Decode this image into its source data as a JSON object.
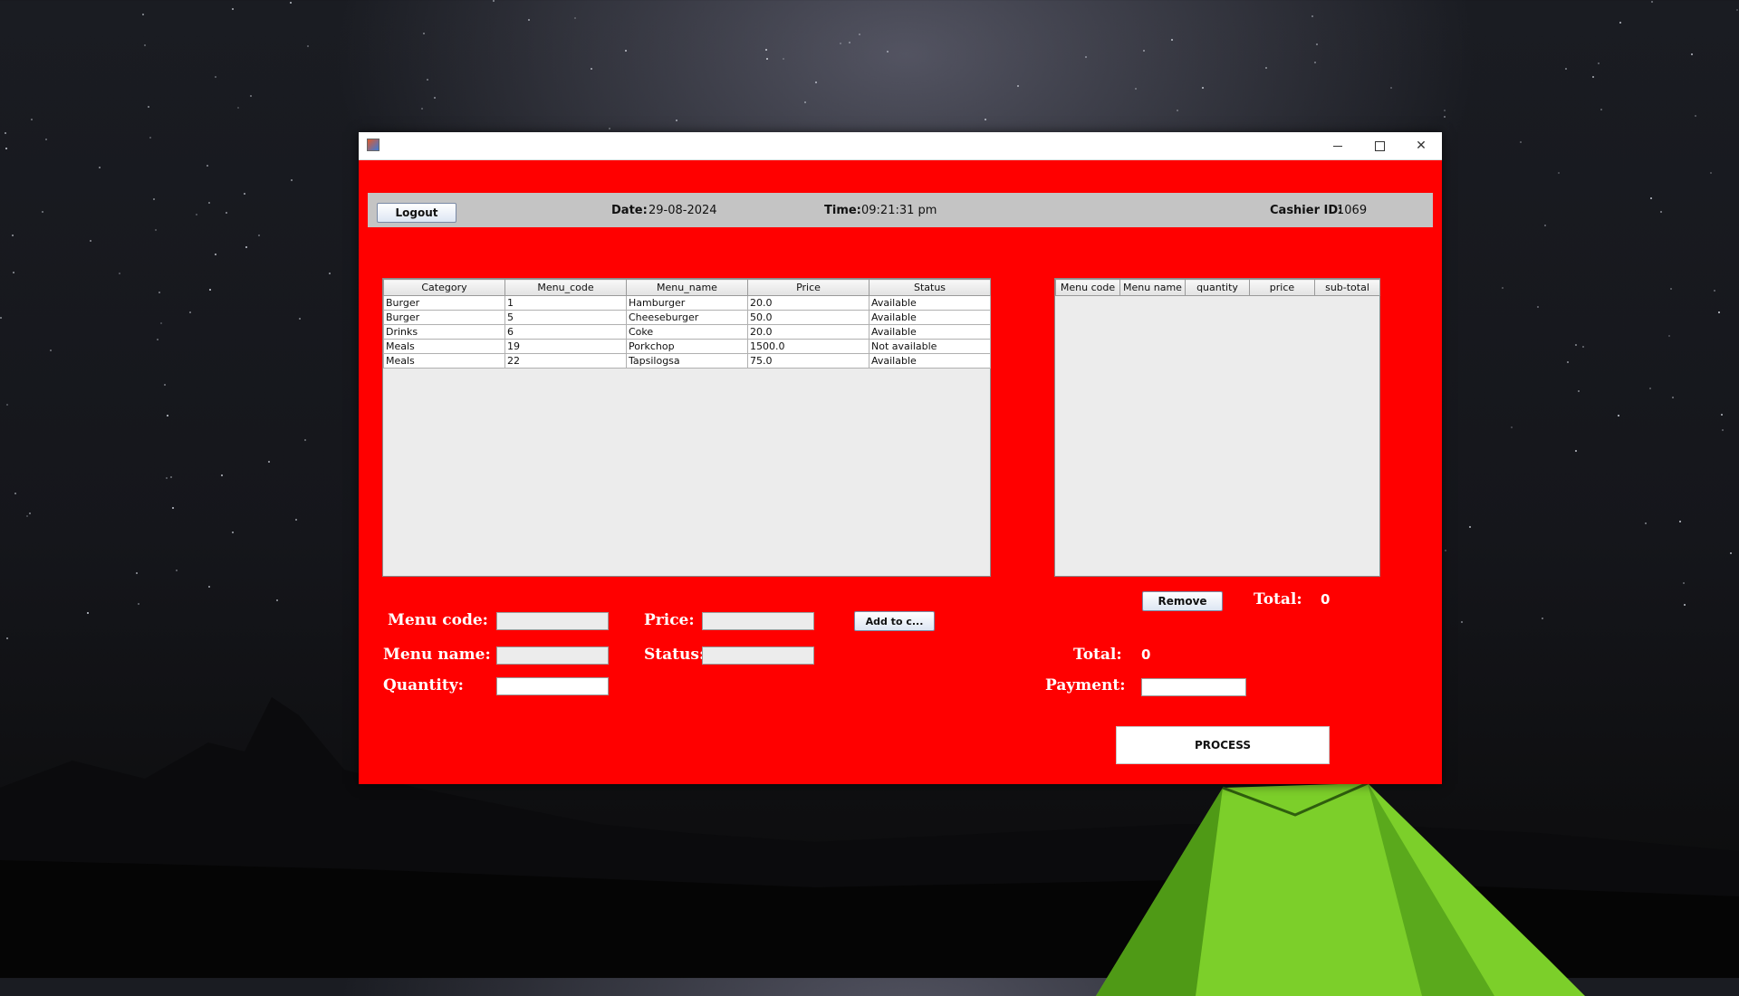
{
  "window": {
    "controls": {
      "minimize": "—",
      "maximize": "☐",
      "close": "✕"
    }
  },
  "topbar": {
    "logout_label": "Logout",
    "date_label": "Date:",
    "date_value": "29-08-2024",
    "time_label": "Time:",
    "time_value": "09:21:31 pm",
    "cashier_label": "Cashier ID:",
    "cashier_value": "1069"
  },
  "menu_table": {
    "columns": [
      "Category",
      "Menu_code",
      "Menu_name",
      "Price",
      "Status"
    ],
    "rows": [
      [
        "Burger",
        "1",
        "Hamburger",
        "20.0",
        "Available"
      ],
      [
        "Burger",
        "5",
        "Cheeseburger",
        "50.0",
        "Available"
      ],
      [
        "Drinks",
        "6",
        "Coke",
        "20.0",
        "Available"
      ],
      [
        "Meals",
        "19",
        "Porkchop",
        "1500.0",
        "Not available"
      ],
      [
        "Meals",
        "22",
        "Tapsilogsa",
        "75.0",
        "Available"
      ]
    ]
  },
  "cart_table": {
    "columns": [
      "Menu code",
      "Menu name",
      "quantity",
      "price",
      "sub-total"
    ],
    "rows": []
  },
  "form": {
    "menu_code_label": "Menu code:",
    "menu_name_label": "Menu name:",
    "quantity_label": "Quantity:",
    "price_label": "Price:",
    "status_label": "Status:",
    "add_to_cart_label": "Add to c...",
    "menu_code_value": "",
    "menu_name_value": "",
    "quantity_value": "",
    "price_value": "",
    "status_value": ""
  },
  "cart_panel": {
    "remove_label": "Remove",
    "total_label_top": "Total:",
    "total_value_top": "0",
    "total_label": "Total:",
    "total_value": "0",
    "payment_label": "Payment:",
    "payment_value": "",
    "process_label": "PROCESS"
  },
  "colors": {
    "window_bg": "#ff0000",
    "topbar_bg": "#c4c4c4"
  }
}
